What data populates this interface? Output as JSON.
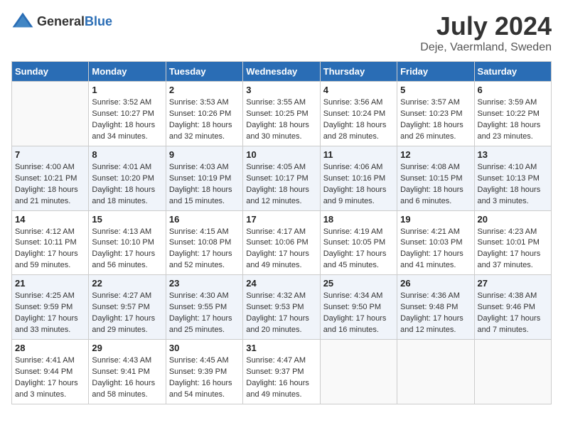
{
  "header": {
    "logo_general": "General",
    "logo_blue": "Blue",
    "month": "July 2024",
    "location": "Deje, Vaermland, Sweden"
  },
  "days_of_week": [
    "Sunday",
    "Monday",
    "Tuesday",
    "Wednesday",
    "Thursday",
    "Friday",
    "Saturday"
  ],
  "weeks": [
    [
      {
        "day": "",
        "sunrise": "",
        "sunset": "",
        "daylight": ""
      },
      {
        "day": "1",
        "sunrise": "Sunrise: 3:52 AM",
        "sunset": "Sunset: 10:27 PM",
        "daylight": "Daylight: 18 hours and 34 minutes."
      },
      {
        "day": "2",
        "sunrise": "Sunrise: 3:53 AM",
        "sunset": "Sunset: 10:26 PM",
        "daylight": "Daylight: 18 hours and 32 minutes."
      },
      {
        "day": "3",
        "sunrise": "Sunrise: 3:55 AM",
        "sunset": "Sunset: 10:25 PM",
        "daylight": "Daylight: 18 hours and 30 minutes."
      },
      {
        "day": "4",
        "sunrise": "Sunrise: 3:56 AM",
        "sunset": "Sunset: 10:24 PM",
        "daylight": "Daylight: 18 hours and 28 minutes."
      },
      {
        "day": "5",
        "sunrise": "Sunrise: 3:57 AM",
        "sunset": "Sunset: 10:23 PM",
        "daylight": "Daylight: 18 hours and 26 minutes."
      },
      {
        "day": "6",
        "sunrise": "Sunrise: 3:59 AM",
        "sunset": "Sunset: 10:22 PM",
        "daylight": "Daylight: 18 hours and 23 minutes."
      }
    ],
    [
      {
        "day": "7",
        "sunrise": "Sunrise: 4:00 AM",
        "sunset": "Sunset: 10:21 PM",
        "daylight": "Daylight: 18 hours and 21 minutes."
      },
      {
        "day": "8",
        "sunrise": "Sunrise: 4:01 AM",
        "sunset": "Sunset: 10:20 PM",
        "daylight": "Daylight: 18 hours and 18 minutes."
      },
      {
        "day": "9",
        "sunrise": "Sunrise: 4:03 AM",
        "sunset": "Sunset: 10:19 PM",
        "daylight": "Daylight: 18 hours and 15 minutes."
      },
      {
        "day": "10",
        "sunrise": "Sunrise: 4:05 AM",
        "sunset": "Sunset: 10:17 PM",
        "daylight": "Daylight: 18 hours and 12 minutes."
      },
      {
        "day": "11",
        "sunrise": "Sunrise: 4:06 AM",
        "sunset": "Sunset: 10:16 PM",
        "daylight": "Daylight: 18 hours and 9 minutes."
      },
      {
        "day": "12",
        "sunrise": "Sunrise: 4:08 AM",
        "sunset": "Sunset: 10:15 PM",
        "daylight": "Daylight: 18 hours and 6 minutes."
      },
      {
        "day": "13",
        "sunrise": "Sunrise: 4:10 AM",
        "sunset": "Sunset: 10:13 PM",
        "daylight": "Daylight: 18 hours and 3 minutes."
      }
    ],
    [
      {
        "day": "14",
        "sunrise": "Sunrise: 4:12 AM",
        "sunset": "Sunset: 10:11 PM",
        "daylight": "Daylight: 17 hours and 59 minutes."
      },
      {
        "day": "15",
        "sunrise": "Sunrise: 4:13 AM",
        "sunset": "Sunset: 10:10 PM",
        "daylight": "Daylight: 17 hours and 56 minutes."
      },
      {
        "day": "16",
        "sunrise": "Sunrise: 4:15 AM",
        "sunset": "Sunset: 10:08 PM",
        "daylight": "Daylight: 17 hours and 52 minutes."
      },
      {
        "day": "17",
        "sunrise": "Sunrise: 4:17 AM",
        "sunset": "Sunset: 10:06 PM",
        "daylight": "Daylight: 17 hours and 49 minutes."
      },
      {
        "day": "18",
        "sunrise": "Sunrise: 4:19 AM",
        "sunset": "Sunset: 10:05 PM",
        "daylight": "Daylight: 17 hours and 45 minutes."
      },
      {
        "day": "19",
        "sunrise": "Sunrise: 4:21 AM",
        "sunset": "Sunset: 10:03 PM",
        "daylight": "Daylight: 17 hours and 41 minutes."
      },
      {
        "day": "20",
        "sunrise": "Sunrise: 4:23 AM",
        "sunset": "Sunset: 10:01 PM",
        "daylight": "Daylight: 17 hours and 37 minutes."
      }
    ],
    [
      {
        "day": "21",
        "sunrise": "Sunrise: 4:25 AM",
        "sunset": "Sunset: 9:59 PM",
        "daylight": "Daylight: 17 hours and 33 minutes."
      },
      {
        "day": "22",
        "sunrise": "Sunrise: 4:27 AM",
        "sunset": "Sunset: 9:57 PM",
        "daylight": "Daylight: 17 hours and 29 minutes."
      },
      {
        "day": "23",
        "sunrise": "Sunrise: 4:30 AM",
        "sunset": "Sunset: 9:55 PM",
        "daylight": "Daylight: 17 hours and 25 minutes."
      },
      {
        "day": "24",
        "sunrise": "Sunrise: 4:32 AM",
        "sunset": "Sunset: 9:53 PM",
        "daylight": "Daylight: 17 hours and 20 minutes."
      },
      {
        "day": "25",
        "sunrise": "Sunrise: 4:34 AM",
        "sunset": "Sunset: 9:50 PM",
        "daylight": "Daylight: 17 hours and 16 minutes."
      },
      {
        "day": "26",
        "sunrise": "Sunrise: 4:36 AM",
        "sunset": "Sunset: 9:48 PM",
        "daylight": "Daylight: 17 hours and 12 minutes."
      },
      {
        "day": "27",
        "sunrise": "Sunrise: 4:38 AM",
        "sunset": "Sunset: 9:46 PM",
        "daylight": "Daylight: 17 hours and 7 minutes."
      }
    ],
    [
      {
        "day": "28",
        "sunrise": "Sunrise: 4:41 AM",
        "sunset": "Sunset: 9:44 PM",
        "daylight": "Daylight: 17 hours and 3 minutes."
      },
      {
        "day": "29",
        "sunrise": "Sunrise: 4:43 AM",
        "sunset": "Sunset: 9:41 PM",
        "daylight": "Daylight: 16 hours and 58 minutes."
      },
      {
        "day": "30",
        "sunrise": "Sunrise: 4:45 AM",
        "sunset": "Sunset: 9:39 PM",
        "daylight": "Daylight: 16 hours and 54 minutes."
      },
      {
        "day": "31",
        "sunrise": "Sunrise: 4:47 AM",
        "sunset": "Sunset: 9:37 PM",
        "daylight": "Daylight: 16 hours and 49 minutes."
      },
      {
        "day": "",
        "sunrise": "",
        "sunset": "",
        "daylight": ""
      },
      {
        "day": "",
        "sunrise": "",
        "sunset": "",
        "daylight": ""
      },
      {
        "day": "",
        "sunrise": "",
        "sunset": "",
        "daylight": ""
      }
    ]
  ]
}
